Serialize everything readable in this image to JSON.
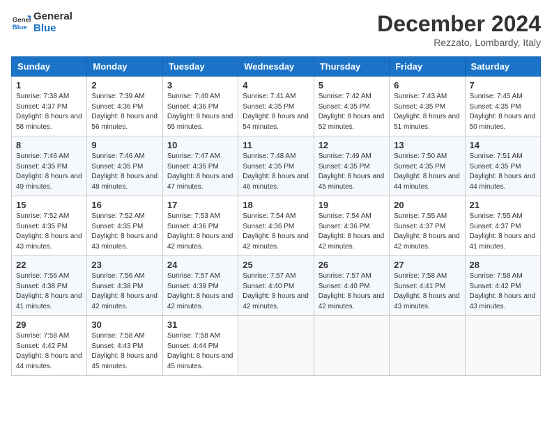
{
  "header": {
    "logo_line1": "General",
    "logo_line2": "Blue",
    "month": "December 2024",
    "location": "Rezzato, Lombardy, Italy"
  },
  "weekdays": [
    "Sunday",
    "Monday",
    "Tuesday",
    "Wednesday",
    "Thursday",
    "Friday",
    "Saturday"
  ],
  "weeks": [
    [
      {
        "day": "1",
        "sunrise": "7:38 AM",
        "sunset": "4:37 PM",
        "daylight": "8 hours and 58 minutes."
      },
      {
        "day": "2",
        "sunrise": "7:39 AM",
        "sunset": "4:36 PM",
        "daylight": "8 hours and 56 minutes."
      },
      {
        "day": "3",
        "sunrise": "7:40 AM",
        "sunset": "4:36 PM",
        "daylight": "8 hours and 55 minutes."
      },
      {
        "day": "4",
        "sunrise": "7:41 AM",
        "sunset": "4:35 PM",
        "daylight": "8 hours and 54 minutes."
      },
      {
        "day": "5",
        "sunrise": "7:42 AM",
        "sunset": "4:35 PM",
        "daylight": "8 hours and 52 minutes."
      },
      {
        "day": "6",
        "sunrise": "7:43 AM",
        "sunset": "4:35 PM",
        "daylight": "8 hours and 51 minutes."
      },
      {
        "day": "7",
        "sunrise": "7:45 AM",
        "sunset": "4:35 PM",
        "daylight": "8 hours and 50 minutes."
      }
    ],
    [
      {
        "day": "8",
        "sunrise": "7:46 AM",
        "sunset": "4:35 PM",
        "daylight": "8 hours and 49 minutes."
      },
      {
        "day": "9",
        "sunrise": "7:46 AM",
        "sunset": "4:35 PM",
        "daylight": "8 hours and 48 minutes."
      },
      {
        "day": "10",
        "sunrise": "7:47 AM",
        "sunset": "4:35 PM",
        "daylight": "8 hours and 47 minutes."
      },
      {
        "day": "11",
        "sunrise": "7:48 AM",
        "sunset": "4:35 PM",
        "daylight": "8 hours and 46 minutes."
      },
      {
        "day": "12",
        "sunrise": "7:49 AM",
        "sunset": "4:35 PM",
        "daylight": "8 hours and 45 minutes."
      },
      {
        "day": "13",
        "sunrise": "7:50 AM",
        "sunset": "4:35 PM",
        "daylight": "8 hours and 44 minutes."
      },
      {
        "day": "14",
        "sunrise": "7:51 AM",
        "sunset": "4:35 PM",
        "daylight": "8 hours and 44 minutes."
      }
    ],
    [
      {
        "day": "15",
        "sunrise": "7:52 AM",
        "sunset": "4:35 PM",
        "daylight": "8 hours and 43 minutes."
      },
      {
        "day": "16",
        "sunrise": "7:52 AM",
        "sunset": "4:35 PM",
        "daylight": "8 hours and 43 minutes."
      },
      {
        "day": "17",
        "sunrise": "7:53 AM",
        "sunset": "4:36 PM",
        "daylight": "8 hours and 42 minutes."
      },
      {
        "day": "18",
        "sunrise": "7:54 AM",
        "sunset": "4:36 PM",
        "daylight": "8 hours and 42 minutes."
      },
      {
        "day": "19",
        "sunrise": "7:54 AM",
        "sunset": "4:36 PM",
        "daylight": "8 hours and 42 minutes."
      },
      {
        "day": "20",
        "sunrise": "7:55 AM",
        "sunset": "4:37 PM",
        "daylight": "8 hours and 42 minutes."
      },
      {
        "day": "21",
        "sunrise": "7:55 AM",
        "sunset": "4:37 PM",
        "daylight": "8 hours and 41 minutes."
      }
    ],
    [
      {
        "day": "22",
        "sunrise": "7:56 AM",
        "sunset": "4:38 PM",
        "daylight": "8 hours and 41 minutes."
      },
      {
        "day": "23",
        "sunrise": "7:56 AM",
        "sunset": "4:38 PM",
        "daylight": "8 hours and 42 minutes."
      },
      {
        "day": "24",
        "sunrise": "7:57 AM",
        "sunset": "4:39 PM",
        "daylight": "8 hours and 42 minutes."
      },
      {
        "day": "25",
        "sunrise": "7:57 AM",
        "sunset": "4:40 PM",
        "daylight": "8 hours and 42 minutes."
      },
      {
        "day": "26",
        "sunrise": "7:57 AM",
        "sunset": "4:40 PM",
        "daylight": "8 hours and 42 minutes."
      },
      {
        "day": "27",
        "sunrise": "7:58 AM",
        "sunset": "4:41 PM",
        "daylight": "8 hours and 43 minutes."
      },
      {
        "day": "28",
        "sunrise": "7:58 AM",
        "sunset": "4:42 PM",
        "daylight": "8 hours and 43 minutes."
      }
    ],
    [
      {
        "day": "29",
        "sunrise": "7:58 AM",
        "sunset": "4:42 PM",
        "daylight": "8 hours and 44 minutes."
      },
      {
        "day": "30",
        "sunrise": "7:58 AM",
        "sunset": "4:43 PM",
        "daylight": "8 hours and 45 minutes."
      },
      {
        "day": "31",
        "sunrise": "7:58 AM",
        "sunset": "4:44 PM",
        "daylight": "8 hours and 45 minutes."
      },
      null,
      null,
      null,
      null
    ]
  ],
  "labels": {
    "sunrise": "Sunrise:",
    "sunset": "Sunset:",
    "daylight": "Daylight:"
  }
}
